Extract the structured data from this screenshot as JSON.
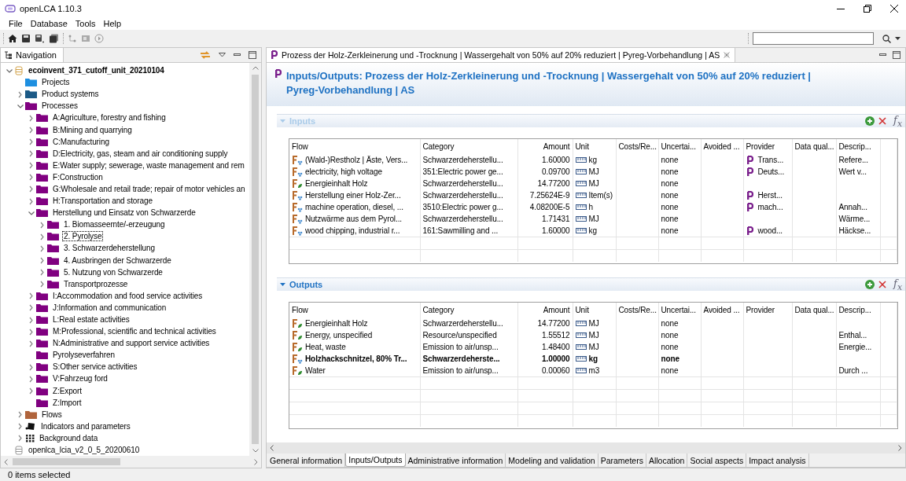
{
  "window": {
    "title": "openLCA 1.10.3"
  },
  "menu": [
    "File",
    "Database",
    "Tools",
    "Help"
  ],
  "navigation": {
    "title": "Navigation",
    "tree": [
      {
        "label": "ecoinvent_371_cutoff_unit_20210104",
        "kind": "database",
        "active": true,
        "expanded": true,
        "children": [
          {
            "label": "Projects",
            "kind": "folder",
            "color": "#1e8fe0"
          },
          {
            "label": "Product systems",
            "kind": "folder",
            "color": "#1c5a86",
            "expanded": false
          },
          {
            "label": "Processes",
            "kind": "folder",
            "color": "#800080",
            "expanded": true,
            "children": [
              {
                "label": "A:Agriculture, forestry and fishing",
                "kind": "folder",
                "color": "#800080",
                "expanded": false
              },
              {
                "label": "B:Mining and quarrying",
                "kind": "folder",
                "color": "#800080",
                "expanded": false
              },
              {
                "label": "C:Manufacturing",
                "kind": "folder",
                "color": "#800080",
                "expanded": false
              },
              {
                "label": "D:Electricity, gas, steam and air conditioning supply",
                "kind": "folder",
                "color": "#800080",
                "expanded": false
              },
              {
                "label": "E:Water supply; sewerage, waste management and rem",
                "kind": "folder",
                "color": "#800080",
                "expanded": false
              },
              {
                "label": "F:Construction",
                "kind": "folder",
                "color": "#800080",
                "expanded": false
              },
              {
                "label": "G:Wholesale and retail trade; repair of motor vehicles an",
                "kind": "folder",
                "color": "#800080",
                "expanded": false
              },
              {
                "label": "H:Transportation and storage",
                "kind": "folder",
                "color": "#800080",
                "expanded": false
              },
              {
                "label": "Herstellung und Einsatz von Schwarzerde",
                "kind": "folder",
                "color": "#800080",
                "expanded": true,
                "children": [
                  {
                    "label": "1. Biomasseernte/-erzeugung",
                    "kind": "folder",
                    "color": "#800080",
                    "expanded": false,
                    "focused": false
                  },
                  {
                    "label": "2. Pyrolyse",
                    "kind": "folder",
                    "color": "#800080",
                    "expanded": false,
                    "focused": true
                  },
                  {
                    "label": "3. Schwarzerdeherstellung",
                    "kind": "folder",
                    "color": "#800080",
                    "expanded": false,
                    "focused": false
                  },
                  {
                    "label": "4. Ausbringen der Schwarzerde",
                    "kind": "folder",
                    "color": "#800080",
                    "expanded": false,
                    "focused": false
                  },
                  {
                    "label": "5. Nutzung von Schwarzerde",
                    "kind": "folder",
                    "color": "#800080",
                    "expanded": false,
                    "focused": false
                  },
                  {
                    "label": "Transportprozesse",
                    "kind": "folder",
                    "color": "#800080",
                    "expanded": false,
                    "focused": false
                  }
                ]
              },
              {
                "label": "I:Accommodation and food service activities",
                "kind": "folder",
                "color": "#800080",
                "expanded": false
              },
              {
                "label": "J:Information and communication",
                "kind": "folder",
                "color": "#800080",
                "expanded": false
              },
              {
                "label": "L:Real estate activities",
                "kind": "folder",
                "color": "#800080",
                "expanded": false
              },
              {
                "label": "M:Professional, scientific and technical activities",
                "kind": "folder",
                "color": "#800080",
                "expanded": false
              },
              {
                "label": "N:Administrative and support service activities",
                "kind": "folder",
                "color": "#800080",
                "expanded": false
              },
              {
                "label": "Pyrolyseverfahren",
                "kind": "folder",
                "color": "#800080"
              },
              {
                "label": "S:Other service activities",
                "kind": "folder",
                "color": "#800080",
                "expanded": false
              },
              {
                "label": "V:Fahrzeug ford",
                "kind": "folder",
                "color": "#800080",
                "expanded": false
              },
              {
                "label": "Z:Export",
                "kind": "folder",
                "color": "#800080",
                "expanded": false
              },
              {
                "label": "Z:Import",
                "kind": "folder",
                "color": "#800080"
              }
            ]
          },
          {
            "label": "Flows",
            "kind": "folder",
            "color": "#b0643c",
            "expanded": false
          },
          {
            "label": "Indicators and parameters",
            "kind": "indicators",
            "expanded": false
          },
          {
            "label": "Background data",
            "kind": "background",
            "expanded": false
          }
        ]
      },
      {
        "label": "openlca_lcia_v2_0_5_20200610",
        "kind": "database",
        "active": false
      }
    ]
  },
  "editor": {
    "tab": {
      "title": "Prozess der Holz-Zerkleinerung und -Trocknung | Wassergehalt von 50% auf 20% reduziert | Pyreg-Vorbehandlung | AS",
      "selected": true
    },
    "title": "Inputs/Outputs: Prozess der Holz-Zerkleinerung und -Trocknung | Wassergehalt von 50% auf 20% reduziert | Pyreg-Vorbehandlung | AS",
    "sections": [
      {
        "title": "Inputs",
        "expanded": true,
        "highlighted": false,
        "formula": "f$_{x}$",
        "columns": [
          "Flow",
          "Category",
          "Amount",
          "Unit",
          "Costs/Re...",
          "Uncertai...",
          "Avoided ...",
          "Provider",
          "Data qual...",
          "Descrip..."
        ],
        "rows": [
          {
            "flow": "(Wald-)Restholz | Äste, Vers...",
            "kind": "product",
            "category": "Schwarzerdeherstellu...",
            "amount": "1.60000",
            "unit": "kg",
            "uncertainty": "none",
            "provider": "Trans...",
            "description": "Refere..."
          },
          {
            "flow": "electricity, high voltage",
            "kind": "product",
            "category": "351:Electric power ge...",
            "amount": "0.09700",
            "unit": "MJ",
            "uncertainty": "none",
            "provider": "Deuts...",
            "description": "Wert v..."
          },
          {
            "flow": "Energieinhalt Holz",
            "kind": "elementary",
            "category": "Schwarzerdeherstellu...",
            "amount": "14.77200",
            "unit": "MJ",
            "uncertainty": "none"
          },
          {
            "flow": "Herstellung einer Holz-Zer...",
            "kind": "product",
            "category": "Schwarzerdeherstellu...",
            "amount": "7.25624E-9",
            "unit": "Item(s)",
            "uncertainty": "none",
            "provider": "Herst..."
          },
          {
            "flow": "machine operation, diesel, ...",
            "kind": "product",
            "category": "3510:Electric power g...",
            "amount": "4.08200E-5",
            "unit": "h",
            "uncertainty": "none",
            "provider": "mach...",
            "description": "Annah..."
          },
          {
            "flow": "Nutzwärme aus dem Pyrol...",
            "kind": "product",
            "category": "Schwarzerdeherstellu...",
            "amount": "1.71431",
            "unit": "MJ",
            "uncertainty": "none",
            "description": "Wärme..."
          },
          {
            "flow": "wood chipping, industrial r...",
            "kind": "product",
            "category": "161:Sawmilling and ...",
            "amount": "1.60000",
            "unit": "kg",
            "uncertainty": "none",
            "provider": "wood...",
            "description": "Häckse..."
          }
        ]
      },
      {
        "title": "Outputs",
        "expanded": true,
        "highlighted": true,
        "formula": "f$_{x}$",
        "columns": [
          "Flow",
          "Category",
          "Amount",
          "Unit",
          "Costs/Re...",
          "Uncertai...",
          "Avoided ...",
          "Provider",
          "Data qual...",
          "Descrip..."
        ],
        "rows": [
          {
            "flow": "Energieinhalt Holz",
            "kind": "elementary",
            "category": "Schwarzerdeherstellu...",
            "amount": "14.77200",
            "unit": "MJ",
            "uncertainty": "none",
            "reference": false
          },
          {
            "flow": "Energy, unspecified",
            "kind": "elementary",
            "category": "Resource/unspecified",
            "amount": "1.55512",
            "unit": "MJ",
            "uncertainty": "none",
            "description": "Enthal...",
            "reference": false
          },
          {
            "flow": "Heat, waste",
            "kind": "elementary",
            "category": "Emission to air/unsp...",
            "amount": "1.48400",
            "unit": "MJ",
            "uncertainty": "none",
            "description": "Energie...",
            "reference": false
          },
          {
            "flow": "Holzhackschnitzel, 80% Tr...",
            "kind": "product",
            "category": "Schwarzerdeherste...",
            "amount": "1.00000",
            "unit": "kg",
            "uncertainty": "none",
            "reference": true
          },
          {
            "flow": "Water",
            "kind": "elementary",
            "category": "Emission to air/unsp...",
            "amount": "0.00060",
            "unit": "m3",
            "uncertainty": "none",
            "description": "Durch ...",
            "reference": false
          }
        ]
      }
    ],
    "tabs": [
      {
        "label": "General information",
        "selected": false
      },
      {
        "label": "Inputs/Outputs",
        "selected": true
      },
      {
        "label": "Administrative information",
        "selected": false
      },
      {
        "label": "Modeling and validation",
        "selected": false
      },
      {
        "label": "Parameters",
        "selected": false
      },
      {
        "label": "Allocation",
        "selected": false
      },
      {
        "label": "Social aspects",
        "selected": false
      },
      {
        "label": "Impact analysis",
        "selected": false
      }
    ]
  },
  "status_bar": "0 items selected"
}
